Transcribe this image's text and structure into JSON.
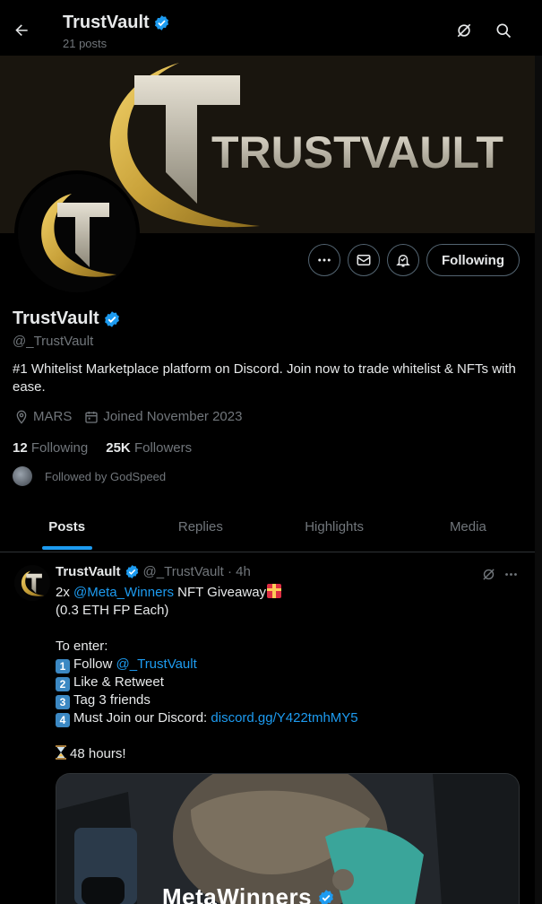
{
  "header": {
    "title": "TrustVault",
    "posts_count": "21 posts"
  },
  "banner": {
    "brand_text": "TRUSTVAULT"
  },
  "profile": {
    "name": "TrustVault",
    "handle": "@_TrustVault",
    "bio": "#1 Whitelist Marketplace platform on Discord. Join now to trade whitelist & NFTs with ease.",
    "location": "MARS",
    "joined": "Joined November 2023",
    "following_count": "12",
    "following_label": "Following",
    "followers_count": "25K",
    "followers_label": "Followers",
    "followed_by": "Followed by GodSpeed",
    "following_button": "Following"
  },
  "tabs": [
    {
      "label": "Posts",
      "active": true
    },
    {
      "label": "Replies",
      "active": false
    },
    {
      "label": "Highlights",
      "active": false
    },
    {
      "label": "Media",
      "active": false
    }
  ],
  "tweet": {
    "author": "TrustVault",
    "handle_time": "@_TrustVault · 4h",
    "line1_pre": "2x ",
    "line1_mention": "@Meta_Winners",
    "line1_post": " NFT Giveaway",
    "line2": "(0.3 ETH FP Each)",
    "line4": "To enter:",
    "step1_num": "1",
    "step1_text": "Follow ",
    "step1_mention": "@_TrustVault",
    "step2_num": "2",
    "step2_text": "Like & Retweet",
    "step3_num": "3",
    "step3_text": "Tag 3 friends",
    "step4_num": "4",
    "step4_text": "Must Join our Discord: ",
    "step4_link": "discord.gg/Y422tmhMY5",
    "line_last": "48 hours!",
    "media_title": "MetaWinners"
  },
  "colors": {
    "accent": "#1d9bf0",
    "gold": "#c9a23a",
    "text": "#e7e9ea",
    "muted": "#71767b"
  }
}
